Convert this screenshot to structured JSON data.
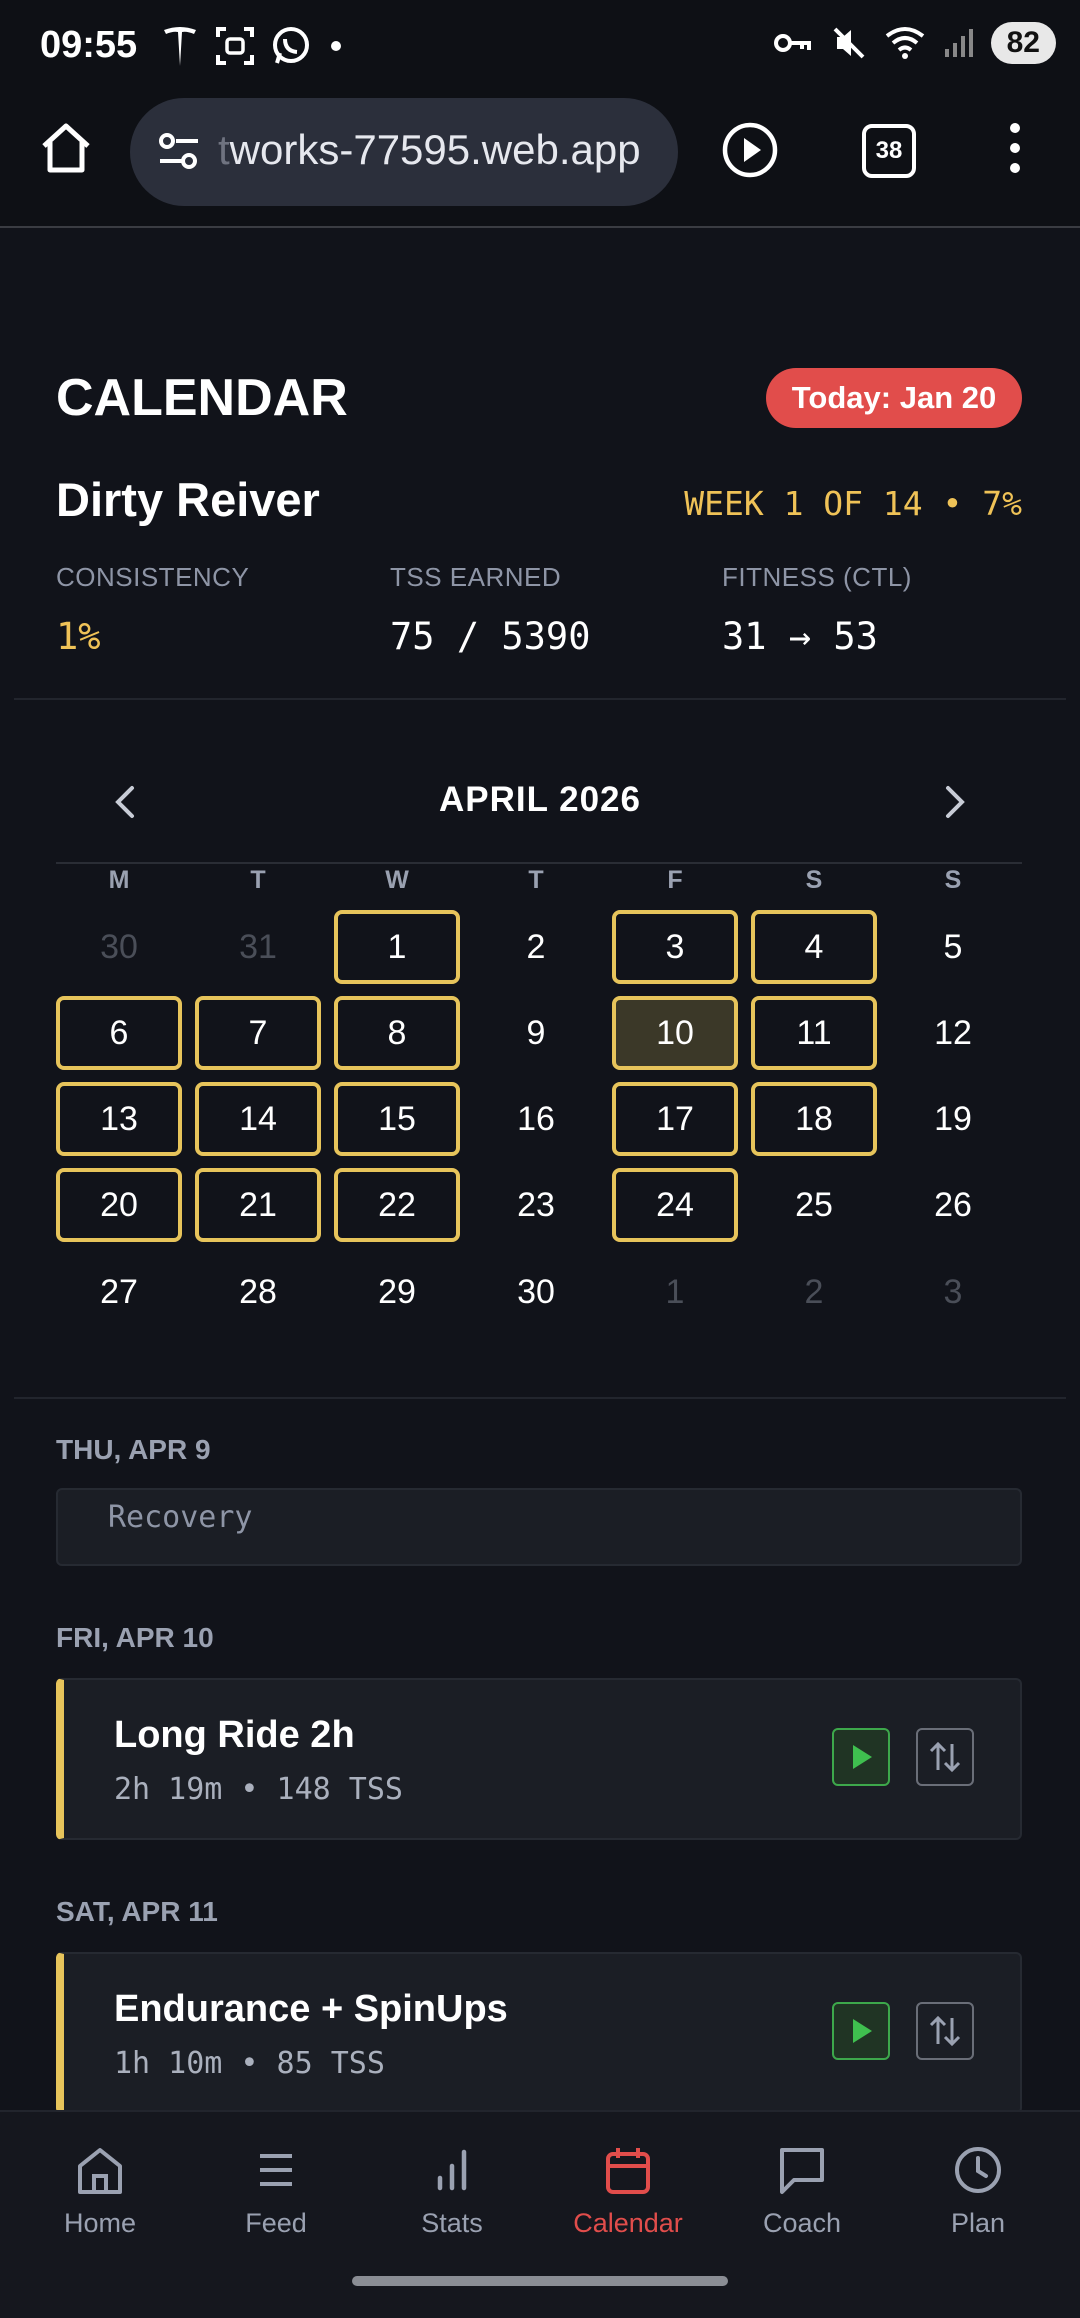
{
  "status_bar": {
    "time": "09:55",
    "battery": "82",
    "left_icons": [
      "tesla-icon",
      "screenshot-icon",
      "whatsapp-icon",
      "dot-icon"
    ],
    "right_icons": [
      "key-icon",
      "mute-icon",
      "wifi-icon",
      "signal-icon"
    ]
  },
  "browser": {
    "url_faded": "t",
    "url": "works-77595.web.app",
    "tab_count": "38"
  },
  "header": {
    "title": "CALENDAR",
    "today_badge": "Today: Jan 20",
    "plan_name": "Dirty Reiver",
    "week_progress": "WEEK 1 OF 14 • 7%"
  },
  "stats": [
    {
      "label": "CONSISTENCY",
      "value": "1%"
    },
    {
      "label": "TSS EARNED",
      "value": "75 / 5390"
    },
    {
      "label": "FITNESS (CTL)",
      "value": "31 → 53"
    }
  ],
  "calendar": {
    "month": "APRIL 2026",
    "weekdays": [
      "M",
      "T",
      "W",
      "T",
      "F",
      "S",
      "S"
    ],
    "weeks": [
      [
        {
          "d": "30",
          "muted": true
        },
        {
          "d": "31",
          "muted": true
        },
        {
          "d": "1",
          "done": true
        },
        {
          "d": "2"
        },
        {
          "d": "3",
          "done": true
        },
        {
          "d": "4",
          "done": true
        },
        {
          "d": "5"
        }
      ],
      [
        {
          "d": "6",
          "done": true
        },
        {
          "d": "7",
          "done": true
        },
        {
          "d": "8",
          "done": true
        },
        {
          "d": "9"
        },
        {
          "d": "10",
          "done": true,
          "selected": true
        },
        {
          "d": "11",
          "done": true
        },
        {
          "d": "12"
        }
      ],
      [
        {
          "d": "13",
          "done": true
        },
        {
          "d": "14",
          "done": true
        },
        {
          "d": "15",
          "done": true
        },
        {
          "d": "16"
        },
        {
          "d": "17",
          "done": true
        },
        {
          "d": "18",
          "done": true
        },
        {
          "d": "19"
        }
      ],
      [
        {
          "d": "20",
          "done": true
        },
        {
          "d": "21",
          "done": true
        },
        {
          "d": "22",
          "done": true
        },
        {
          "d": "23"
        },
        {
          "d": "24",
          "done": true
        },
        {
          "d": "25"
        },
        {
          "d": "26"
        }
      ],
      [
        {
          "d": "27"
        },
        {
          "d": "28"
        },
        {
          "d": "29"
        },
        {
          "d": "30"
        },
        {
          "d": "1",
          "muted": true
        },
        {
          "d": "2",
          "muted": true
        },
        {
          "d": "3",
          "muted": true
        }
      ]
    ]
  },
  "schedule": [
    {
      "date": "THU, APR 9",
      "title": "",
      "detail": "Recovery"
    },
    {
      "date": "FRI, APR 10",
      "title": "Long Ride 2h",
      "detail": "2h 19m • 148 TSS"
    },
    {
      "date": "SAT, APR 11",
      "title": "Endurance + SpinUps",
      "detail": "1h 10m • 85 TSS"
    }
  ],
  "nav": [
    {
      "label": "Home",
      "icon": "home-icon"
    },
    {
      "label": "Feed",
      "icon": "feed-icon"
    },
    {
      "label": "Stats",
      "icon": "stats-icon"
    },
    {
      "label": "Calendar",
      "icon": "calendar-icon",
      "active": true
    },
    {
      "label": "Coach",
      "icon": "chat-icon"
    },
    {
      "label": "Plan",
      "icon": "clock-icon"
    }
  ],
  "colors": {
    "accent_yellow": "#e7c45b",
    "today_red": "#e14d4b",
    "play_green": "#3da84b",
    "background": "#11131a"
  }
}
